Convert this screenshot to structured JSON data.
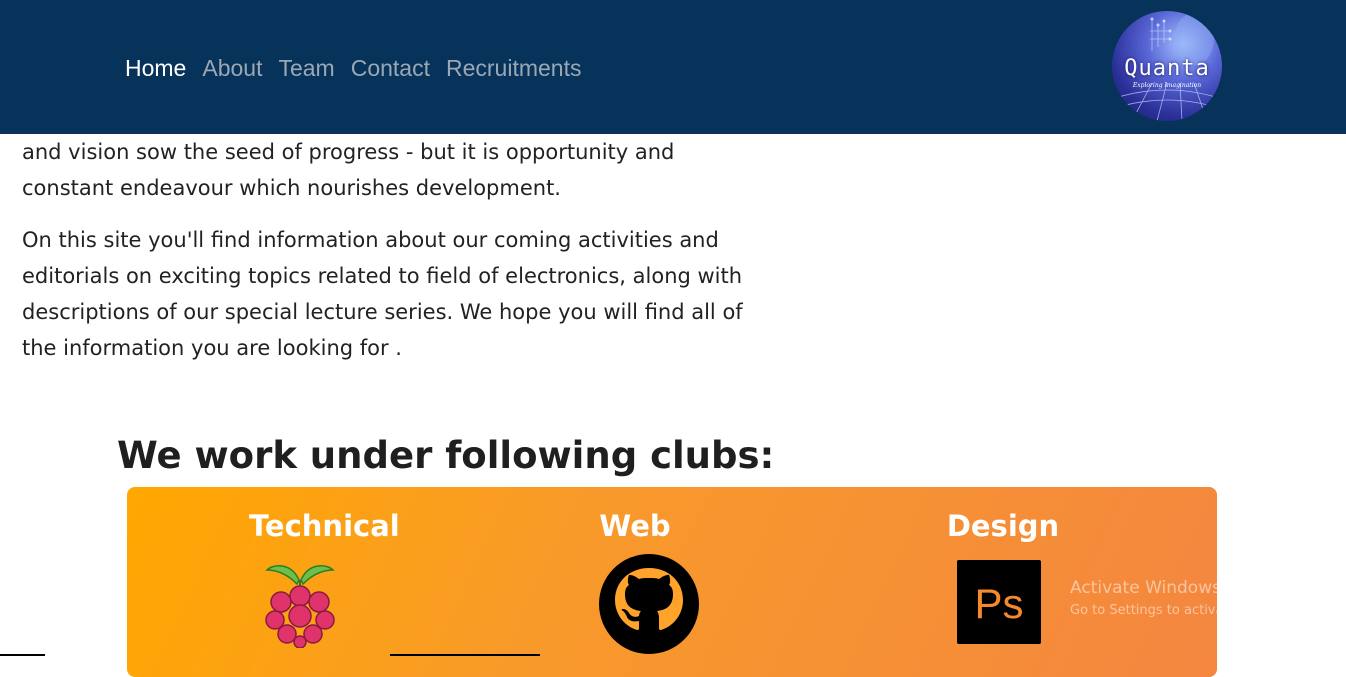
{
  "nav": {
    "items": [
      {
        "label": "Home",
        "active": true
      },
      {
        "label": "About",
        "active": false
      },
      {
        "label": "Team",
        "active": false
      },
      {
        "label": "Contact",
        "active": false
      },
      {
        "label": "Recruitments",
        "active": false
      }
    ],
    "background": "#073259"
  },
  "logo": {
    "text": "Quanta",
    "tagline": "Exploring Imagination"
  },
  "intro": {
    "paragraphs": [
      "and vision sow the seed of progress - but it is opportunity and constant endeavour which nourishes development.",
      "On this site you'll find information about our coming activities and editorials on exciting topics related to field of electronics, along with descriptions of our special lecture series. We hope you will find all of the information you are looking for ."
    ]
  },
  "clubs": {
    "heading": "We work under following clubs:",
    "items": [
      {
        "title": "Technical",
        "icon": "raspberry-pi-icon"
      },
      {
        "title": "Web",
        "icon": "github-icon"
      },
      {
        "title": "Design",
        "icon": "photoshop-icon"
      }
    ],
    "gradient": [
      "#ffa800",
      "#f48640"
    ]
  },
  "watermark": {
    "title": "Activate Windows",
    "subtitle": "Go to Settings to activate Windows."
  }
}
